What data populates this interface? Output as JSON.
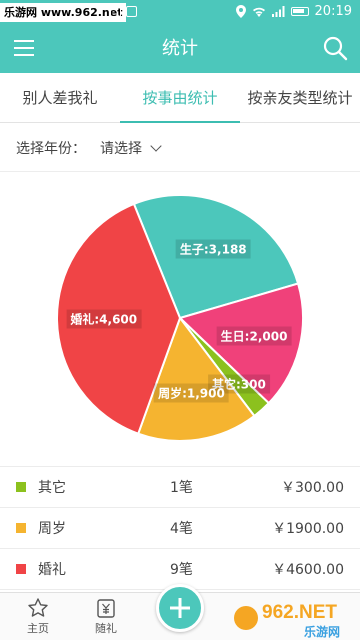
{
  "status_bar": {
    "watermark": "乐游网 www.962.net",
    "time": "20:19"
  },
  "header": {
    "title": "统计"
  },
  "tabs": [
    {
      "label": "别人差我礼",
      "active": false
    },
    {
      "label": "按事由统计",
      "active": true
    },
    {
      "label": "按亲友类型统计",
      "active": false
    }
  ],
  "filter": {
    "year_label": "选择年份：",
    "year_value": "请选择"
  },
  "chart_data": {
    "type": "pie",
    "slices": [
      {
        "label": "生子:3,188",
        "name": "生子",
        "value": 3188,
        "color": "#4cc7bb"
      },
      {
        "label": "生日:2,000",
        "name": "生日",
        "value": 2000,
        "color": "#f0417a"
      },
      {
        "label": "其它:300",
        "name": "其它",
        "value": 300,
        "color": "#8cc11e"
      },
      {
        "label": "周岁:1,900",
        "name": "周岁",
        "value": 1900,
        "color": "#f5b430"
      },
      {
        "label": "婚礼:4,600",
        "name": "婚礼",
        "value": 4600,
        "color": "#f04446"
      }
    ]
  },
  "list": [
    {
      "name": "其它",
      "count": "1笔",
      "amount": "￥300.00",
      "color": "#8cc11e"
    },
    {
      "name": "周岁",
      "count": "4笔",
      "amount": "￥1900.00",
      "color": "#f5b430"
    },
    {
      "name": "婚礼",
      "count": "9笔",
      "amount": "￥4600.00",
      "color": "#f04446"
    }
  ],
  "bottom_nav": {
    "home_label": "主页",
    "gift_label": "随礼"
  },
  "logo": {
    "text": "962.NET",
    "subtext": "乐游网"
  },
  "colors": {
    "accent": "#4cc7bb"
  }
}
